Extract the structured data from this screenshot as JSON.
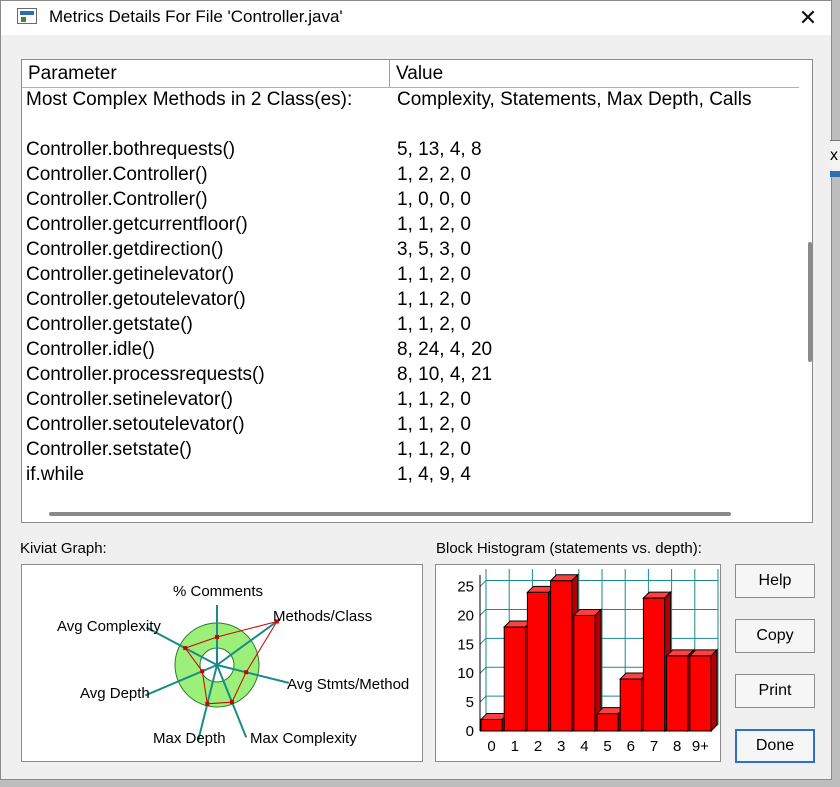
{
  "window": {
    "title": "Metrics Details For File 'Controller.java'",
    "close_glyph": "✕"
  },
  "table": {
    "columns": [
      "Parameter",
      "Value"
    ],
    "rows": [
      [
        "Most Complex Methods in 2 Class(es):",
        "Complexity, Statements, Max Depth, Calls"
      ],
      [
        "",
        ""
      ],
      [
        "Controller.bothrequests()",
        "5, 13, 4, 8"
      ],
      [
        "Controller.Controller()",
        "1, 2, 2, 0"
      ],
      [
        "Controller.Controller()",
        "1, 0, 0, 0"
      ],
      [
        "Controller.getcurrentfloor()",
        "1, 1, 2, 0"
      ],
      [
        "Controller.getdirection()",
        "3, 5, 3, 0"
      ],
      [
        "Controller.getinelevator()",
        "1, 1, 2, 0"
      ],
      [
        "Controller.getoutelevator()",
        "1, 1, 2, 0"
      ],
      [
        "Controller.getstate()",
        "1, 1, 2, 0"
      ],
      [
        "Controller.idle()",
        "8, 24, 4, 20"
      ],
      [
        "Controller.processrequests()",
        "8, 10, 4, 21"
      ],
      [
        "Controller.setinelevator()",
        "1, 1, 2, 0"
      ],
      [
        "Controller.setoutelevator()",
        "1, 1, 2, 0"
      ],
      [
        "Controller.setstate()",
        "1, 1, 2, 0"
      ],
      [
        "if.while",
        "1, 4, 9, 4"
      ]
    ]
  },
  "kiviat": {
    "label": "Kiviat Graph:",
    "axes": [
      "% Comments",
      "Methods/Class",
      "Avg Stmts/Method",
      "Max Complexity",
      "Max Depth",
      "Avg Depth",
      "Avg Complexity"
    ],
    "colors": {
      "ring": "#9cf07a",
      "axis": "#1a8a8a",
      "polygon": "#cc0000"
    }
  },
  "histogram": {
    "label": "Block Histogram (statements vs. depth):",
    "colors": {
      "bar": "#ff0000",
      "grid": "#1a8a8a"
    }
  },
  "chart_data": {
    "type": "bar",
    "title": "Block Histogram (statements vs. depth):",
    "categories": [
      "0",
      "1",
      "2",
      "3",
      "4",
      "5",
      "6",
      "7",
      "8",
      "9+"
    ],
    "values": [
      2,
      18,
      24,
      26,
      20,
      3,
      9,
      23,
      13,
      13
    ],
    "ylim": [
      0,
      27
    ],
    "yticks": [
      0,
      5,
      10,
      15,
      20,
      25
    ],
    "grid": true
  },
  "buttons": {
    "help": "Help",
    "copy": "Copy",
    "print": "Print",
    "done": "Done"
  },
  "side_fragment": "x"
}
